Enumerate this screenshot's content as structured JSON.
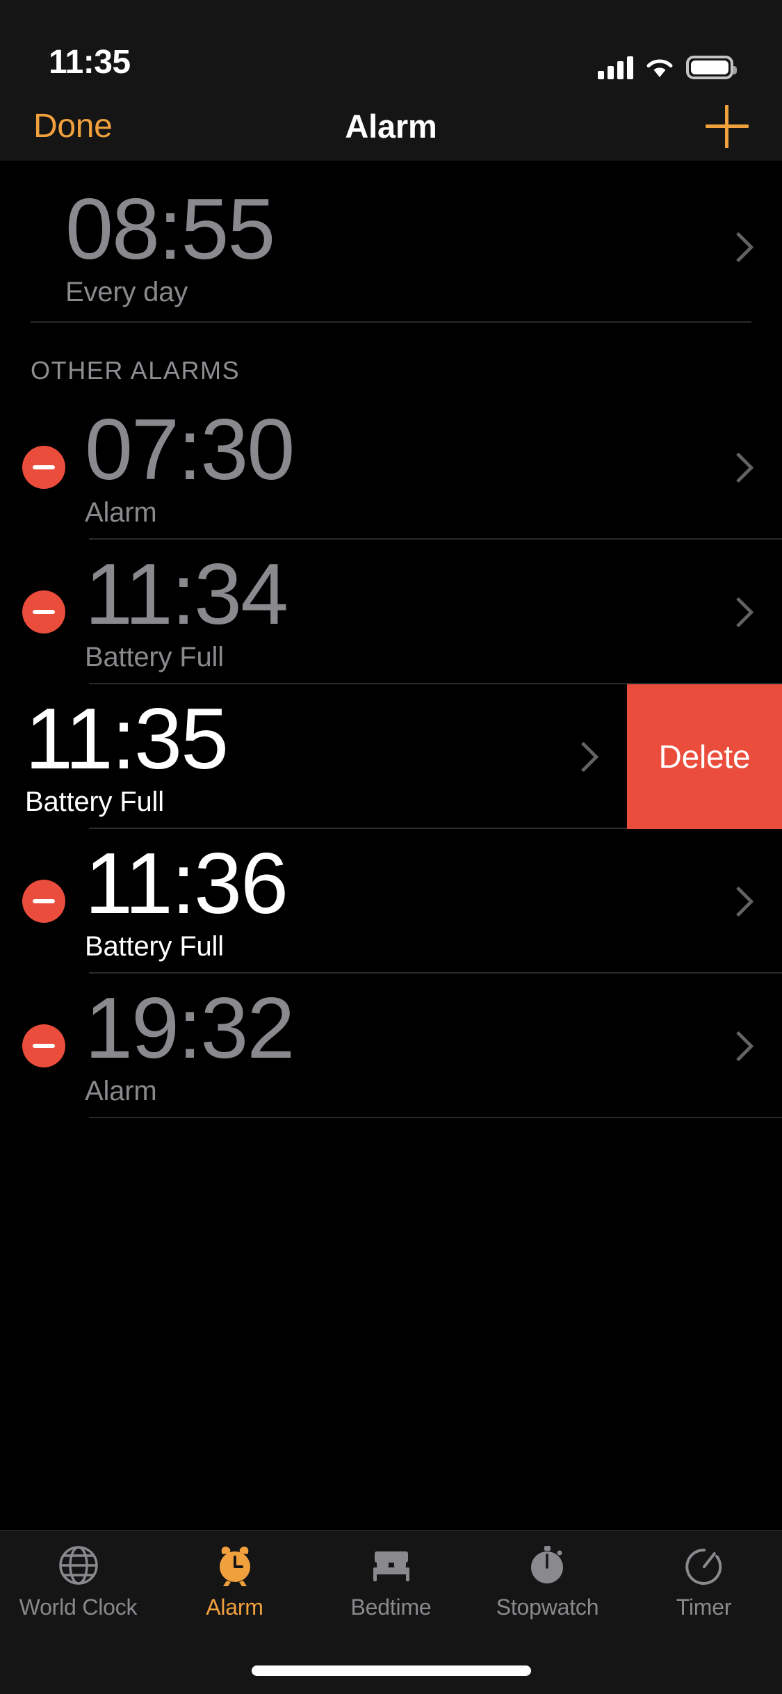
{
  "status_bar": {
    "time": "11:35",
    "signal_icon": "cellular-signal-icon",
    "wifi_icon": "wifi-icon",
    "battery_icon": "battery-full-icon"
  },
  "nav_bar": {
    "done_label": "Done",
    "title": "Alarm",
    "add_icon": "plus-icon"
  },
  "colors": {
    "accent_orange": "#F0A03C",
    "destructive_red": "#EB4D3D",
    "disabled_gray": "#8A8A8E",
    "enabled_white": "#FFFFFF",
    "background": "#000000",
    "chrome": "#151515"
  },
  "sections": [
    {
      "header": "",
      "alarms": [
        {
          "time": "08:55",
          "label": "Every day",
          "enabled": false,
          "has_delete_handle": false,
          "swiped": false
        }
      ]
    },
    {
      "header": "OTHER ALARMS",
      "alarms": [
        {
          "time": "07:30",
          "label": "Alarm",
          "enabled": false,
          "has_delete_handle": true,
          "swiped": false
        },
        {
          "time": "11:34",
          "label": "Battery Full",
          "enabled": false,
          "has_delete_handle": true,
          "swiped": false
        },
        {
          "time": "11:35",
          "label": "Battery Full",
          "enabled": true,
          "has_delete_handle": true,
          "swiped": true,
          "delete_label": "Delete"
        },
        {
          "time": "11:36",
          "label": "Battery Full",
          "enabled": true,
          "has_delete_handle": true,
          "swiped": false
        },
        {
          "time": "19:32",
          "label": "Alarm",
          "enabled": false,
          "has_delete_handle": true,
          "swiped": false
        }
      ]
    }
  ],
  "tab_bar": {
    "items": [
      {
        "label": "World Clock",
        "icon": "globe-icon",
        "active": false
      },
      {
        "label": "Alarm",
        "icon": "alarm-clock-icon",
        "active": true
      },
      {
        "label": "Bedtime",
        "icon": "bed-icon",
        "active": false
      },
      {
        "label": "Stopwatch",
        "icon": "stopwatch-icon",
        "active": false
      },
      {
        "label": "Timer",
        "icon": "timer-icon",
        "active": false
      }
    ]
  }
}
